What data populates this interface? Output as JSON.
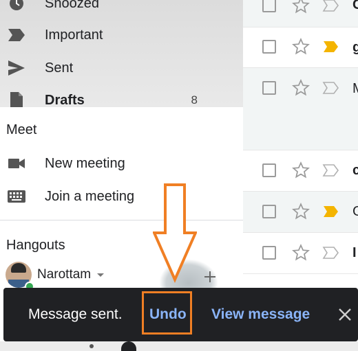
{
  "nav": {
    "snoozed": "Snoozed",
    "important": "Important",
    "sent": "Sent",
    "drafts": "Drafts",
    "drafts_count": "8"
  },
  "meet": {
    "title": "Meet",
    "new_meeting": "New meeting",
    "join_meeting": "Join a meeting"
  },
  "hangouts": {
    "title": "Hangouts",
    "user": "Narottam"
  },
  "emails": [
    {
      "sender": "G",
      "important": false,
      "read": true
    },
    {
      "sender": "g",
      "important": true,
      "read": false
    },
    {
      "sender": "M",
      "important": false,
      "read": true
    },
    {
      "sender": "c",
      "important": false,
      "read": false
    },
    {
      "sender": "G",
      "important": true,
      "read": true
    },
    {
      "sender": "I",
      "important": false,
      "read": false
    }
  ],
  "snackbar": {
    "message": "Message sent.",
    "undo": "Undo",
    "view": "View message"
  },
  "colors": {
    "snackbar_bg": "#202124",
    "link": "#8ab4f8",
    "highlight": "#f07f24",
    "important_marker": "#f4b400"
  }
}
